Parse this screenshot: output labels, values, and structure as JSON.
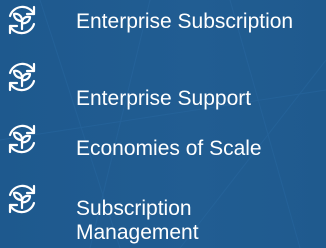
{
  "colors": {
    "background": "#1f5a8f",
    "text": "#ffffff",
    "icon": "#ffffff"
  },
  "items": [
    {
      "label": "Enterprise Subscription",
      "icon": "sprout-refresh-icon"
    },
    {
      "label": "Enterprise Support",
      "icon": "sprout-refresh-icon"
    },
    {
      "label": "Economies of Scale",
      "icon": "sprout-refresh-icon"
    },
    {
      "label": "Subscription Management",
      "icon": "sprout-refresh-icon"
    }
  ]
}
